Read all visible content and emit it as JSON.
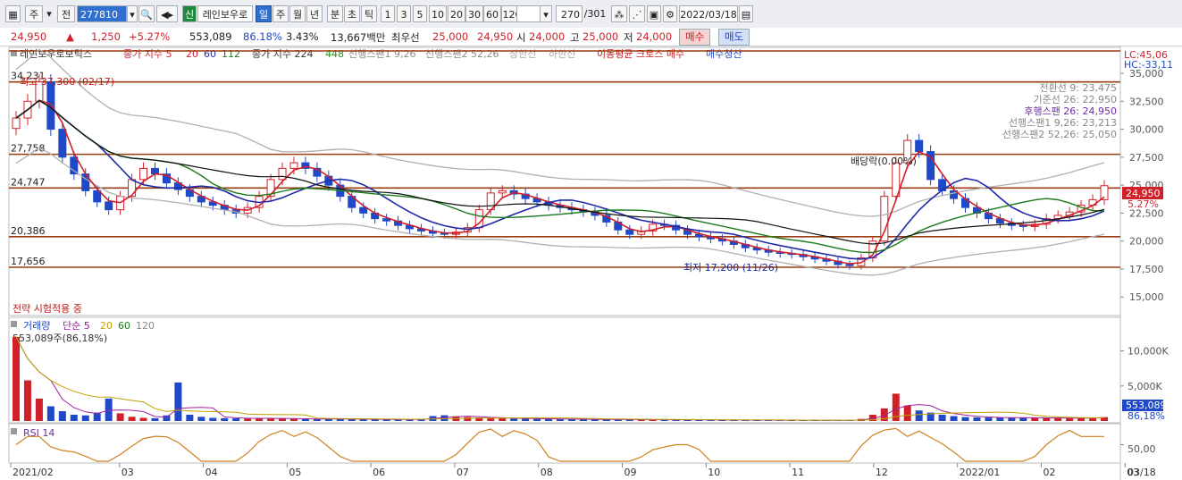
{
  "toolbar": {
    "period_short": "주",
    "prev_label": "전",
    "code": "277810",
    "badge": "신",
    "company": "레인보우로",
    "periods": [
      "일",
      "주",
      "월",
      "년",
      "분",
      "초",
      "틱"
    ],
    "active_period": "일",
    "intervals": [
      "1",
      "3",
      "5",
      "10",
      "20",
      "30",
      "60",
      "120"
    ],
    "count": "270",
    "count_total": "/301",
    "date": "2022/03/18",
    "icons": [
      "grid-icon",
      "search-icon",
      "speaker-icon",
      "candle-icon",
      "chart-icon",
      "save-icon",
      "gear-icon",
      "calendar-icon"
    ]
  },
  "quote": {
    "price": "24,950",
    "change_arrow": "▲",
    "change": "1,250",
    "change_pct": "+5.27%",
    "volume": "553,089",
    "vol_ratio": "86.18%",
    "turnover": "3.43%",
    "amount": "13,667백만",
    "best_label": "최우선",
    "best_ask": "25,000",
    "best_bid": "24,950",
    "open_label": "시",
    "open": "24,000",
    "high_label": "고",
    "high": "25,000",
    "low_label": "저",
    "low": "24,000",
    "buy_label": "매수",
    "sell_label": "매도"
  },
  "legend": {
    "name": "레인보우로보틱스",
    "ma": "종가 지수 5",
    "ma20": "20",
    "ma60": "60",
    "ma112": "112",
    "ma224": "종가 지수 224",
    "ma448": "448",
    "ichimoku1": "선행스팬1 9,26",
    "ichimoku2": "선행스팬2 52,26",
    "upper": "상한선",
    "lower": "하한선",
    "cross": "이동평균 크로스 매수",
    "cross_sell": "매수청산"
  },
  "main_chart": {
    "lc": "LC:45,06",
    "hc": "HC:-33,11",
    "max_note": "최고 37,300 (02/17)",
    "min_note": "최저 17,200 (11/26)",
    "dividend": "배당락(0.00%)",
    "status": "전략 시험적용 중",
    "levels": [
      "34,231",
      "27,758",
      "24,747",
      "20,386",
      "17,656"
    ],
    "info": [
      "전환선 9: 23,475",
      "기준선 26: 22,950",
      "후행스팬 26: 24,950",
      "선행스팬1 9,26: 23,213",
      "선행스팬2 52,26: 25,050"
    ],
    "price_box": "24,950",
    "price_pct": "5.27%",
    "y_ticks": [
      "35,000",
      "32,500",
      "30,000",
      "27,500",
      "25,000",
      "22,500",
      "20,000",
      "17,500",
      "15,000"
    ]
  },
  "volume_chart": {
    "label": "거래량",
    "ma_label": "단순 5",
    "ma20": "20",
    "ma60": "60",
    "ma120": "120",
    "current": "553,089주(86,18%)",
    "y_ticks": [
      "10,000K",
      "5,000K"
    ],
    "box": "553,089",
    "box_pct": "86,18%"
  },
  "rsi_chart": {
    "label": "RSI 14",
    "tick": "50,00"
  },
  "x_axis": {
    "labels": [
      "2021/02",
      "03",
      "04",
      "05",
      "06",
      "07",
      "08",
      "09",
      "10",
      "11",
      "12",
      "2022/01",
      "02",
      "03"
    ],
    "end": "03/18"
  },
  "colors": {
    "up": "#d0202a",
    "down": "#1f49c8",
    "level": "#9a3d10",
    "ma5": "#d0202a",
    "ma20": "#1e2aa8",
    "ma60": "#1a7a1a",
    "ma112": "#111111"
  },
  "chart_data": {
    "type": "candlestick",
    "x_range": [
      "2021/02",
      "2022/03/18"
    ],
    "price_ylim": [
      13500,
      37000
    ],
    "close": [
      31000,
      32500,
      34231,
      30000,
      27500,
      26000,
      24500,
      23500,
      22800,
      24000,
      25500,
      26500,
      26000,
      25200,
      24600,
      24000,
      23500,
      23200,
      22800,
      22500,
      23000,
      24000,
      25500,
      26500,
      27000,
      26500,
      25800,
      25000,
      24000,
      23000,
      22500,
      22000,
      21800,
      21400,
      21100,
      20900,
      20700,
      20600,
      20800,
      21200,
      22800,
      24300,
      24500,
      24200,
      23800,
      23500,
      23200,
      23000,
      22800,
      22600,
      22300,
      21700,
      21000,
      20600,
      20900,
      21500,
      21400,
      21000,
      20600,
      20400,
      20200,
      20000,
      19700,
      19400,
      19200,
      19000,
      18900,
      18800,
      18600,
      18400,
      18200,
      17900,
      17800,
      18500,
      20000,
      24000,
      27000,
      29000,
      28000,
      25500,
      24500,
      23800,
      23000,
      22500,
      22000,
      21600,
      21400,
      21300,
      21500,
      22000,
      22300,
      22600,
      23200,
      23700,
      24950
    ],
    "volume_k": [
      12000,
      5800,
      3200,
      2100,
      1400,
      900,
      800,
      1200,
      3200,
      1100,
      600,
      450,
      400,
      800,
      5500,
      900,
      600,
      450,
      400,
      380,
      350,
      420,
      380,
      340,
      300,
      280,
      260,
      300,
      260,
      250,
      240,
      230,
      220,
      210,
      220,
      260,
      700,
      820,
      650,
      560,
      480,
      420,
      380,
      360,
      340,
      300,
      280,
      260,
      240,
      230,
      220,
      210,
      200,
      190,
      200,
      180,
      170,
      160,
      155,
      150,
      140,
      135,
      130,
      125,
      120,
      115,
      110,
      108,
      105,
      100,
      98,
      96,
      95,
      300,
      900,
      1800,
      3900,
      2200,
      1500,
      1200,
      900,
      700,
      560,
      520,
      500,
      480,
      460,
      450,
      440,
      430,
      420,
      410,
      420,
      480,
      553
    ],
    "ichimoku_cloud": "shown",
    "bollinger": "shown",
    "levels": [
      34231,
      27758,
      24747,
      20386,
      17656
    ]
  }
}
